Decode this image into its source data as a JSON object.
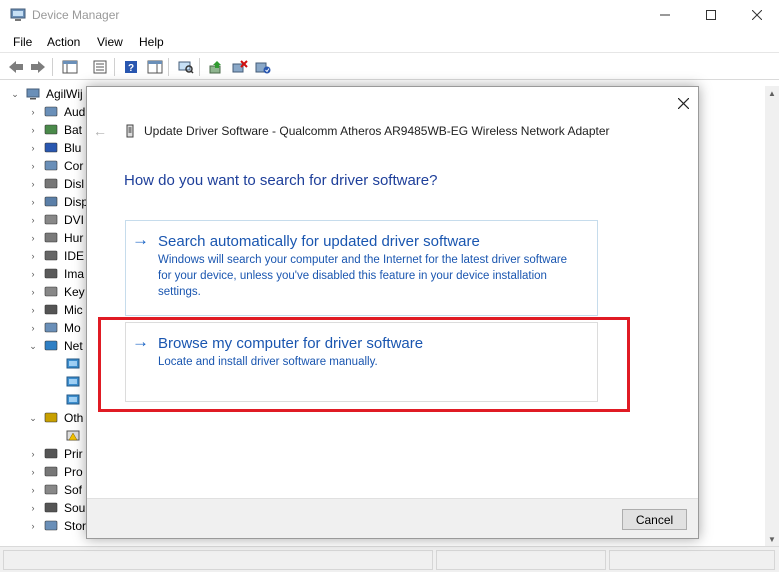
{
  "window": {
    "title": "Device Manager",
    "app_icon": "device-manager-icon"
  },
  "menu": [
    "File",
    "Action",
    "View",
    "Help"
  ],
  "toolbar_icons": [
    "back-icon",
    "forward-icon",
    "show-hide-tree-icon",
    "properties-icon",
    "help-icon",
    "action-pane-icon",
    "scan-hardware-icon",
    "update-driver-icon",
    "uninstall-device-icon",
    "enable-device-icon"
  ],
  "tree": {
    "root": "AgilWij",
    "items": [
      {
        "label": "Aud",
        "icon": "audio-icon"
      },
      {
        "label": "Bat",
        "icon": "battery-icon"
      },
      {
        "label": "Blu",
        "icon": "bluetooth-icon"
      },
      {
        "label": "Cor",
        "icon": "computer-icon"
      },
      {
        "label": "Disl",
        "icon": "disk-drive-icon"
      },
      {
        "label": "Disp",
        "icon": "display-adapter-icon"
      },
      {
        "label": "DVI",
        "icon": "dvd-drive-icon"
      },
      {
        "label": "Hur",
        "icon": "hid-icon"
      },
      {
        "label": "IDE",
        "icon": "ide-controller-icon"
      },
      {
        "label": "Ima",
        "icon": "imaging-device-icon"
      },
      {
        "label": "Key",
        "icon": "keyboard-icon"
      },
      {
        "label": "Mic",
        "icon": "mouse-icon"
      },
      {
        "label": "Mo",
        "icon": "monitor-icon"
      },
      {
        "label": "Net",
        "icon": "network-adapter-icon"
      },
      {
        "label": "Oth",
        "icon": "other-devices-icon"
      },
      {
        "label": "Prir",
        "icon": "print-queue-icon"
      },
      {
        "label": "Pro",
        "icon": "processor-icon"
      },
      {
        "label": "Sof",
        "icon": "software-device-icon"
      },
      {
        "label": "Sou",
        "icon": "sound-icon"
      },
      {
        "label": "Storage controllers",
        "icon": "storage-controller-icon"
      }
    ]
  },
  "dialog": {
    "header": "Update Driver Software - Qualcomm Atheros AR9485WB-EG Wireless Network Adapter",
    "question": "How do you want to search for driver software?",
    "options": [
      {
        "title": "Search automatically for updated driver software",
        "desc_lines": [
          "Windows will search your computer and the Internet for the latest driver software",
          "for your device, unless you've disabled this feature in your device installation",
          "settings."
        ]
      },
      {
        "title": "Browse my computer for driver software",
        "desc_lines": [
          "Locate and install driver software manually."
        ]
      }
    ],
    "arrow_glyph": "→",
    "cancel": "Cancel"
  },
  "colors": {
    "link_blue": "#1a56b0",
    "question_blue": "#1e3f9a",
    "highlight_red": "#e01b24"
  }
}
